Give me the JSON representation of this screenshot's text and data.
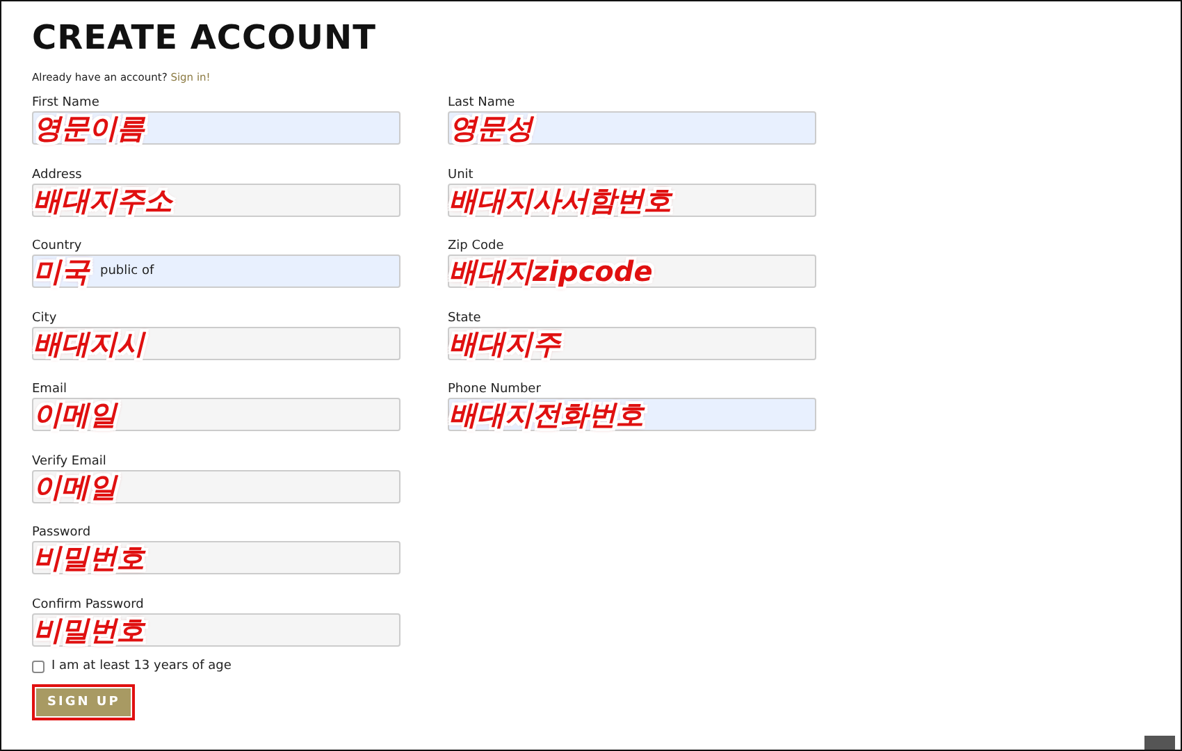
{
  "title": "CREATE ACCOUNT",
  "signin_prompt": {
    "text": "Already have an account?",
    "link": "Sign in!"
  },
  "columns": [
    {
      "fields": [
        {
          "label": "First Name",
          "autofilled": true,
          "annotation": "영문이름"
        },
        {
          "label": "Address",
          "autofilled": false,
          "annotation": "배대지주소"
        },
        {
          "label": "Country",
          "autofilled": true,
          "annotation": "미국",
          "value": "public of"
        },
        {
          "label": "City",
          "autofilled": false,
          "annotation": "배대지시"
        },
        {
          "label": "Email",
          "autofilled": false,
          "annotation": "이메일"
        },
        {
          "label": "Verify Email",
          "autofilled": false,
          "annotation": "이메일"
        },
        {
          "label": "Password",
          "autofilled": false,
          "annotation": "비밀번호"
        },
        {
          "label": "Confirm Password",
          "autofilled": false,
          "annotation": "비밀번호"
        }
      ]
    },
    {
      "fields": [
        {
          "label": "Last Name",
          "autofilled": true,
          "annotation": "영문성"
        },
        {
          "label": "Unit",
          "autofilled": false,
          "annotation": "배대지사서함번호"
        },
        {
          "label": "Zip Code",
          "autofilled": false,
          "annotation": "배대지zipcode"
        },
        {
          "label": "State",
          "autofilled": false,
          "annotation": "배대지주"
        },
        {
          "label": "Phone Number",
          "autofilled": true,
          "annotation": "배대지전화번호"
        }
      ]
    }
  ],
  "age_check": {
    "label": "I am at least 13 years of age",
    "checked": false
  },
  "signup_button": {
    "label": "SIGN UP",
    "highlighted": true
  }
}
